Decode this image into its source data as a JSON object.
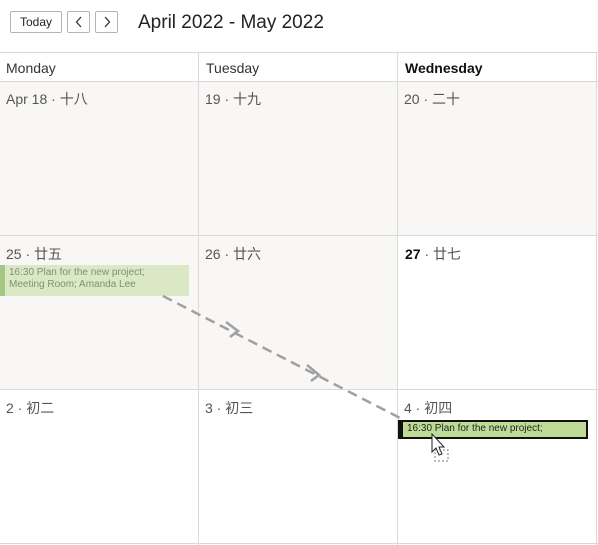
{
  "toolbar": {
    "today_label": "Today",
    "prev_icon": "chevron-left-icon",
    "next_icon": "chevron-right-icon",
    "range_title": "April 2022 - May 2022"
  },
  "columns": [
    {
      "label": "Monday",
      "current": false
    },
    {
      "label": "Tuesday",
      "current": false
    },
    {
      "label": "Wednesday",
      "current": true
    }
  ],
  "weeks": [
    [
      {
        "day": "Apr 18",
        "lunar": "十八"
      },
      {
        "day": "19",
        "lunar": "十九"
      },
      {
        "day": "20",
        "lunar": "二十"
      }
    ],
    [
      {
        "day": "25",
        "lunar": "廿五"
      },
      {
        "day": "26",
        "lunar": "廿六"
      },
      {
        "day": "27",
        "lunar": "廿七",
        "today": true
      }
    ],
    [
      {
        "day": "2",
        "lunar": "初二"
      },
      {
        "day": "3",
        "lunar": "初三"
      },
      {
        "day": "4",
        "lunar": "初四"
      }
    ]
  ],
  "separator": " · ",
  "event_original": {
    "line1": "16:30 Plan for the new project;",
    "line2": "Meeting Room; Amanda Lee"
  },
  "event_drag": {
    "text": "16:30 Plan for the new project;"
  },
  "colors": {
    "event_fill": "#dbe8c6",
    "event_bar": "#a6c784",
    "drag_fill": "#bfdc96",
    "today_border": "#5d8a2e",
    "arrow": "#a0a0a0"
  }
}
